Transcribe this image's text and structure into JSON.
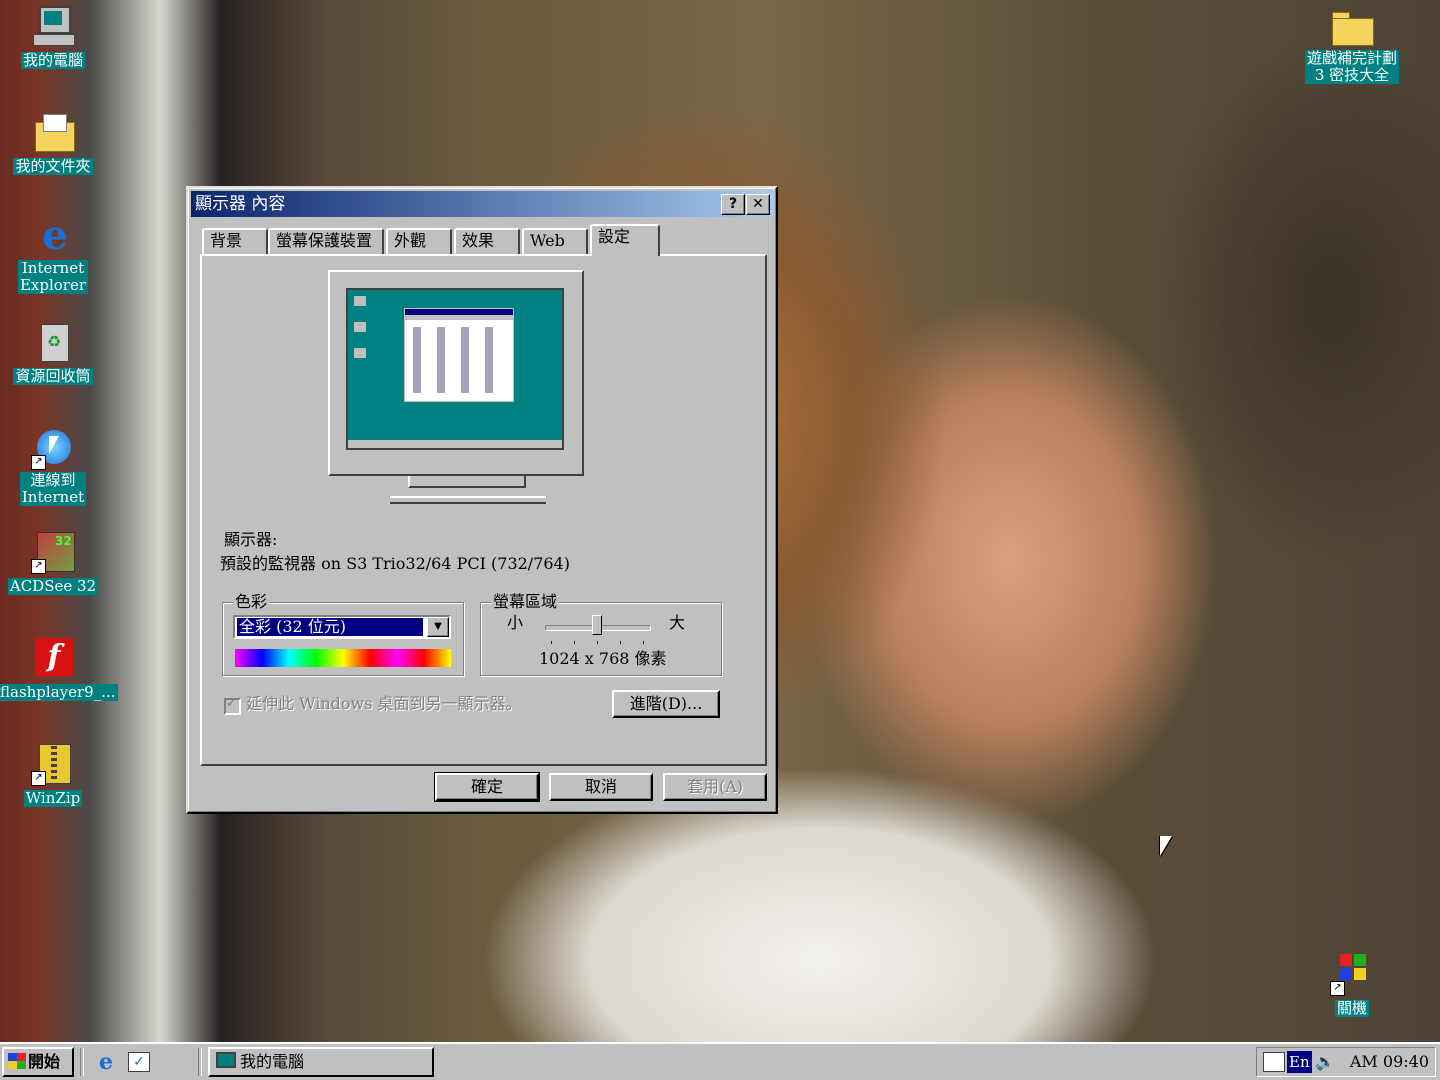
{
  "desktop": {
    "icons": [
      {
        "label": "我的電腦"
      },
      {
        "label": "我的文件夾"
      },
      {
        "label": "Internet\nExplorer"
      },
      {
        "label": "資源回收筒"
      },
      {
        "label": "連線到\nInternet"
      },
      {
        "label": "ACDSee 32"
      },
      {
        "label": "flashplayer9_..."
      },
      {
        "label": "WinZip"
      },
      {
        "label": "遊戲補完計劃\n3 密技大全"
      },
      {
        "label": "關機"
      }
    ]
  },
  "dialog": {
    "title": "顯示器 內容",
    "help_button": "?",
    "close_button": "✕",
    "tabs": [
      {
        "label": "背景"
      },
      {
        "label": "螢幕保護裝置"
      },
      {
        "label": "外觀"
      },
      {
        "label": "效果"
      },
      {
        "label": "Web"
      },
      {
        "label": "設定"
      }
    ],
    "active_tab": "設定",
    "display_label": "顯示器:",
    "display_value": "預設的監視器 on S3 Trio32/64 PCI (732/764)",
    "colors": {
      "group_label": "色彩",
      "selected": "全彩 (32 位元)"
    },
    "screen_area": {
      "group_label": "螢幕區域",
      "min_label": "小",
      "max_label": "大",
      "value_text": "1024 x 768 像素",
      "slider_position": 0.5
    },
    "extend_checkbox": {
      "label": "延伸此 Windows 桌面到另一顯示器。",
      "checked": true,
      "enabled": false
    },
    "advanced_button": "進階(D)...",
    "ok_button": "確定",
    "cancel_button": "取消",
    "apply_button": "套用(A)"
  },
  "taskbar": {
    "start_label": "開始",
    "task_label": "我的電腦",
    "lang": "En",
    "clock": "AM 09:40"
  }
}
